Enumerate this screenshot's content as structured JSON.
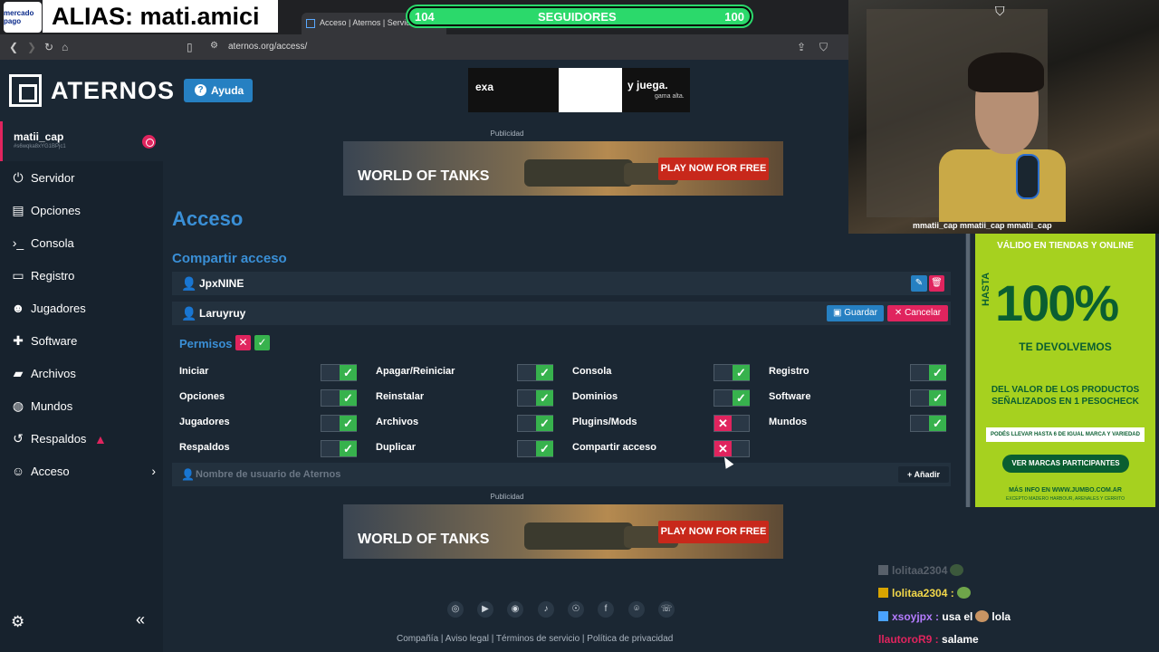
{
  "overlay": {
    "mercadopago": "mercado pago",
    "alias": "ALIAS: mati.amici",
    "followers": {
      "current": "104",
      "label": "SEGUIDORES",
      "goal": "100",
      "progress": 1.0
    },
    "social": "mmatii_cap   mmatii_cap   mmatii_cap"
  },
  "browser": {
    "tab_title": "Acceso | Aternos | Servidor",
    "url": "aternos.org/access/"
  },
  "header": {
    "logo": "ATERNOS",
    "help_label": "Ayuda",
    "top_ad": {
      "left": "exa",
      "right": "y juega.",
      "sub": "gama alta."
    }
  },
  "sidebar": {
    "user": {
      "name": "matii_cap",
      "id": "#s6wqka8xYG1BPjc1"
    },
    "items": [
      {
        "label": "Servidor",
        "icon": "power-icon"
      },
      {
        "label": "Opciones",
        "icon": "options-icon"
      },
      {
        "label": "Consola",
        "icon": "console-icon"
      },
      {
        "label": "Registro",
        "icon": "log-icon"
      },
      {
        "label": "Jugadores",
        "icon": "players-icon"
      },
      {
        "label": "Software",
        "icon": "puzzle-icon"
      },
      {
        "label": "Archivos",
        "icon": "folder-icon"
      },
      {
        "label": "Mundos",
        "icon": "globe-icon"
      },
      {
        "label": "Respaldos",
        "icon": "backup-icon"
      },
      {
        "label": "Acceso",
        "icon": "access-icon"
      }
    ]
  },
  "main": {
    "ad_label": "Publicidad",
    "ad_logo": "WORLD OF TANKS",
    "ad_button": "PLAY NOW FOR FREE",
    "title": "Acceso",
    "section": "Compartir acceso",
    "users": [
      {
        "name": "JpxNINE"
      },
      {
        "name": "Laruyruy"
      }
    ],
    "save_label": "Guardar",
    "cancel_label": "Cancelar",
    "permissions_label": "Permisos",
    "permissions": [
      [
        {
          "label": "Iniciar",
          "on": true
        },
        {
          "label": "Apagar/Reiniciar",
          "on": true
        },
        {
          "label": "Consola",
          "on": true
        },
        {
          "label": "Registro",
          "on": true
        }
      ],
      [
        {
          "label": "Opciones",
          "on": true
        },
        {
          "label": "Reinstalar",
          "on": true
        },
        {
          "label": "Dominios",
          "on": true
        },
        {
          "label": "Software",
          "on": true
        }
      ],
      [
        {
          "label": "Jugadores",
          "on": true
        },
        {
          "label": "Archivos",
          "on": true
        },
        {
          "label": "Plugins/Mods",
          "on": false
        },
        {
          "label": "Mundos",
          "on": true
        }
      ],
      [
        {
          "label": "Respaldos",
          "on": true
        },
        {
          "label": "Duplicar",
          "on": true
        },
        {
          "label": "Compartir acceso",
          "on": false
        }
      ]
    ],
    "add_placeholder": "Nombre de usuario de Aternos",
    "add_label": "Añadir",
    "footer_links": "Compañía  |  Aviso legal  |  Términos de servicio  |  Política de privacidad"
  },
  "promo": {
    "top": "VÁLIDO EN TIENDAS Y ONLINE",
    "hasta": "HASTA",
    "big": "100%",
    "devol": "TE DEVOLVEMOS",
    "valor": "DEL VALOR DE LOS PRODUCTOS SEÑALIZADOS EN 1 PESOCHECK",
    "bar": "PODÉS LLEVAR HASTA 6 DE IGUAL MARCA Y VARIEDAD",
    "button": "VER MARCAS PARTICIPANTES",
    "web": "MÁS INFO EN WWW.JUMBO.COM.AR",
    "exc": "EXCEPTO MADERO HARBOUR, ARENALES Y CERRITO"
  },
  "chat": [
    {
      "user": "lolitaa2304",
      "text": "",
      "color": "#58606a"
    },
    {
      "user": "lolitaa2304 :",
      "text": "",
      "color": "#f2d74a"
    },
    {
      "user": "xsoyjpx :",
      "text": "usa el",
      "text2": "lola",
      "color": "#b57cff"
    },
    {
      "user": "llautoroR9 :",
      "text": "salame",
      "color": "#e0245e"
    }
  ],
  "colors": {
    "accent": "#3a8fd6",
    "danger": "#e0245e",
    "success": "#37b24d",
    "green": "#2bd96b"
  }
}
